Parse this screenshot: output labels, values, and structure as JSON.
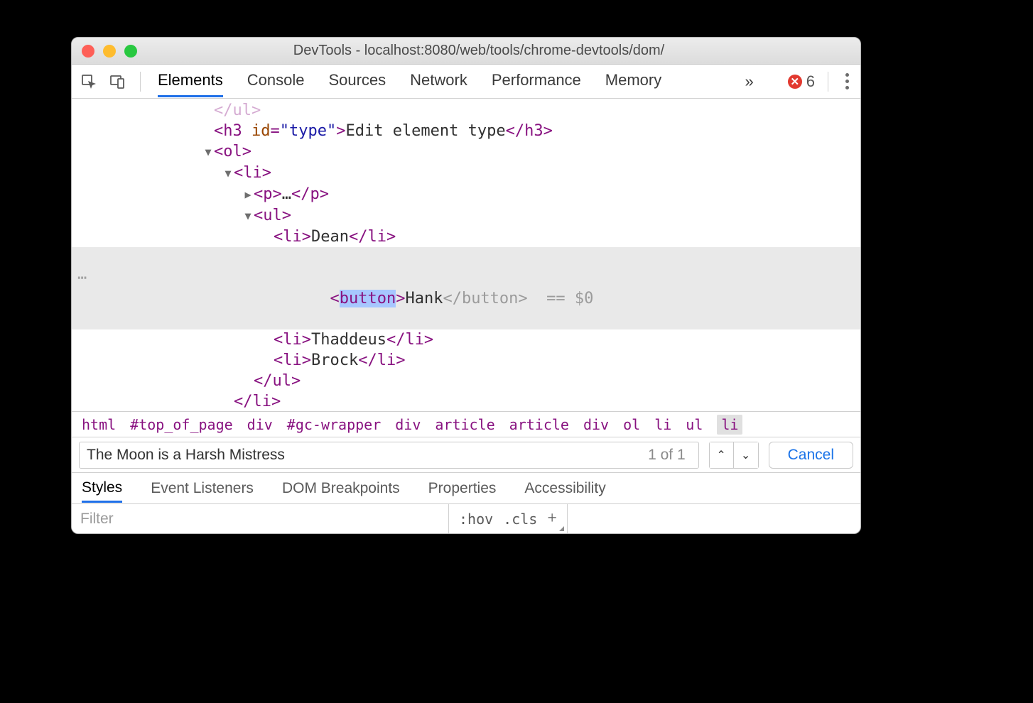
{
  "window": {
    "title": "DevTools - localhost:8080/web/tools/chrome-devtools/dom/"
  },
  "tabs": [
    "Elements",
    "Console",
    "Sources",
    "Network",
    "Performance",
    "Memory"
  ],
  "active_tab_index": 0,
  "overflow_glyph": "»",
  "error_count": "6",
  "dom": {
    "faded_close": "</ul>",
    "h3_id": "type",
    "h3_text": "Edit element type",
    "p_ellipsis": "…",
    "items": {
      "dean": "Dean",
      "hank": "Hank",
      "thaddeus": "Thaddeus",
      "brock": "Brock"
    },
    "edit_token": "button",
    "sel_ref": "== $0",
    "li_ellipsis": "…"
  },
  "breadcrumbs": [
    "html",
    "#top_of_page",
    "div",
    "#gc-wrapper",
    "div",
    "article",
    "article",
    "div",
    "ol",
    "li",
    "ul",
    "li"
  ],
  "search": {
    "value": "The Moon is a Harsh Mistress",
    "count": "1 of 1",
    "cancel": "Cancel"
  },
  "subtabs": [
    "Styles",
    "Event Listeners",
    "DOM Breakpoints",
    "Properties",
    "Accessibility"
  ],
  "active_subtab_index": 0,
  "filter_placeholder": "Filter",
  "style_btns": {
    "hov": ":hov",
    "cls": ".cls"
  }
}
